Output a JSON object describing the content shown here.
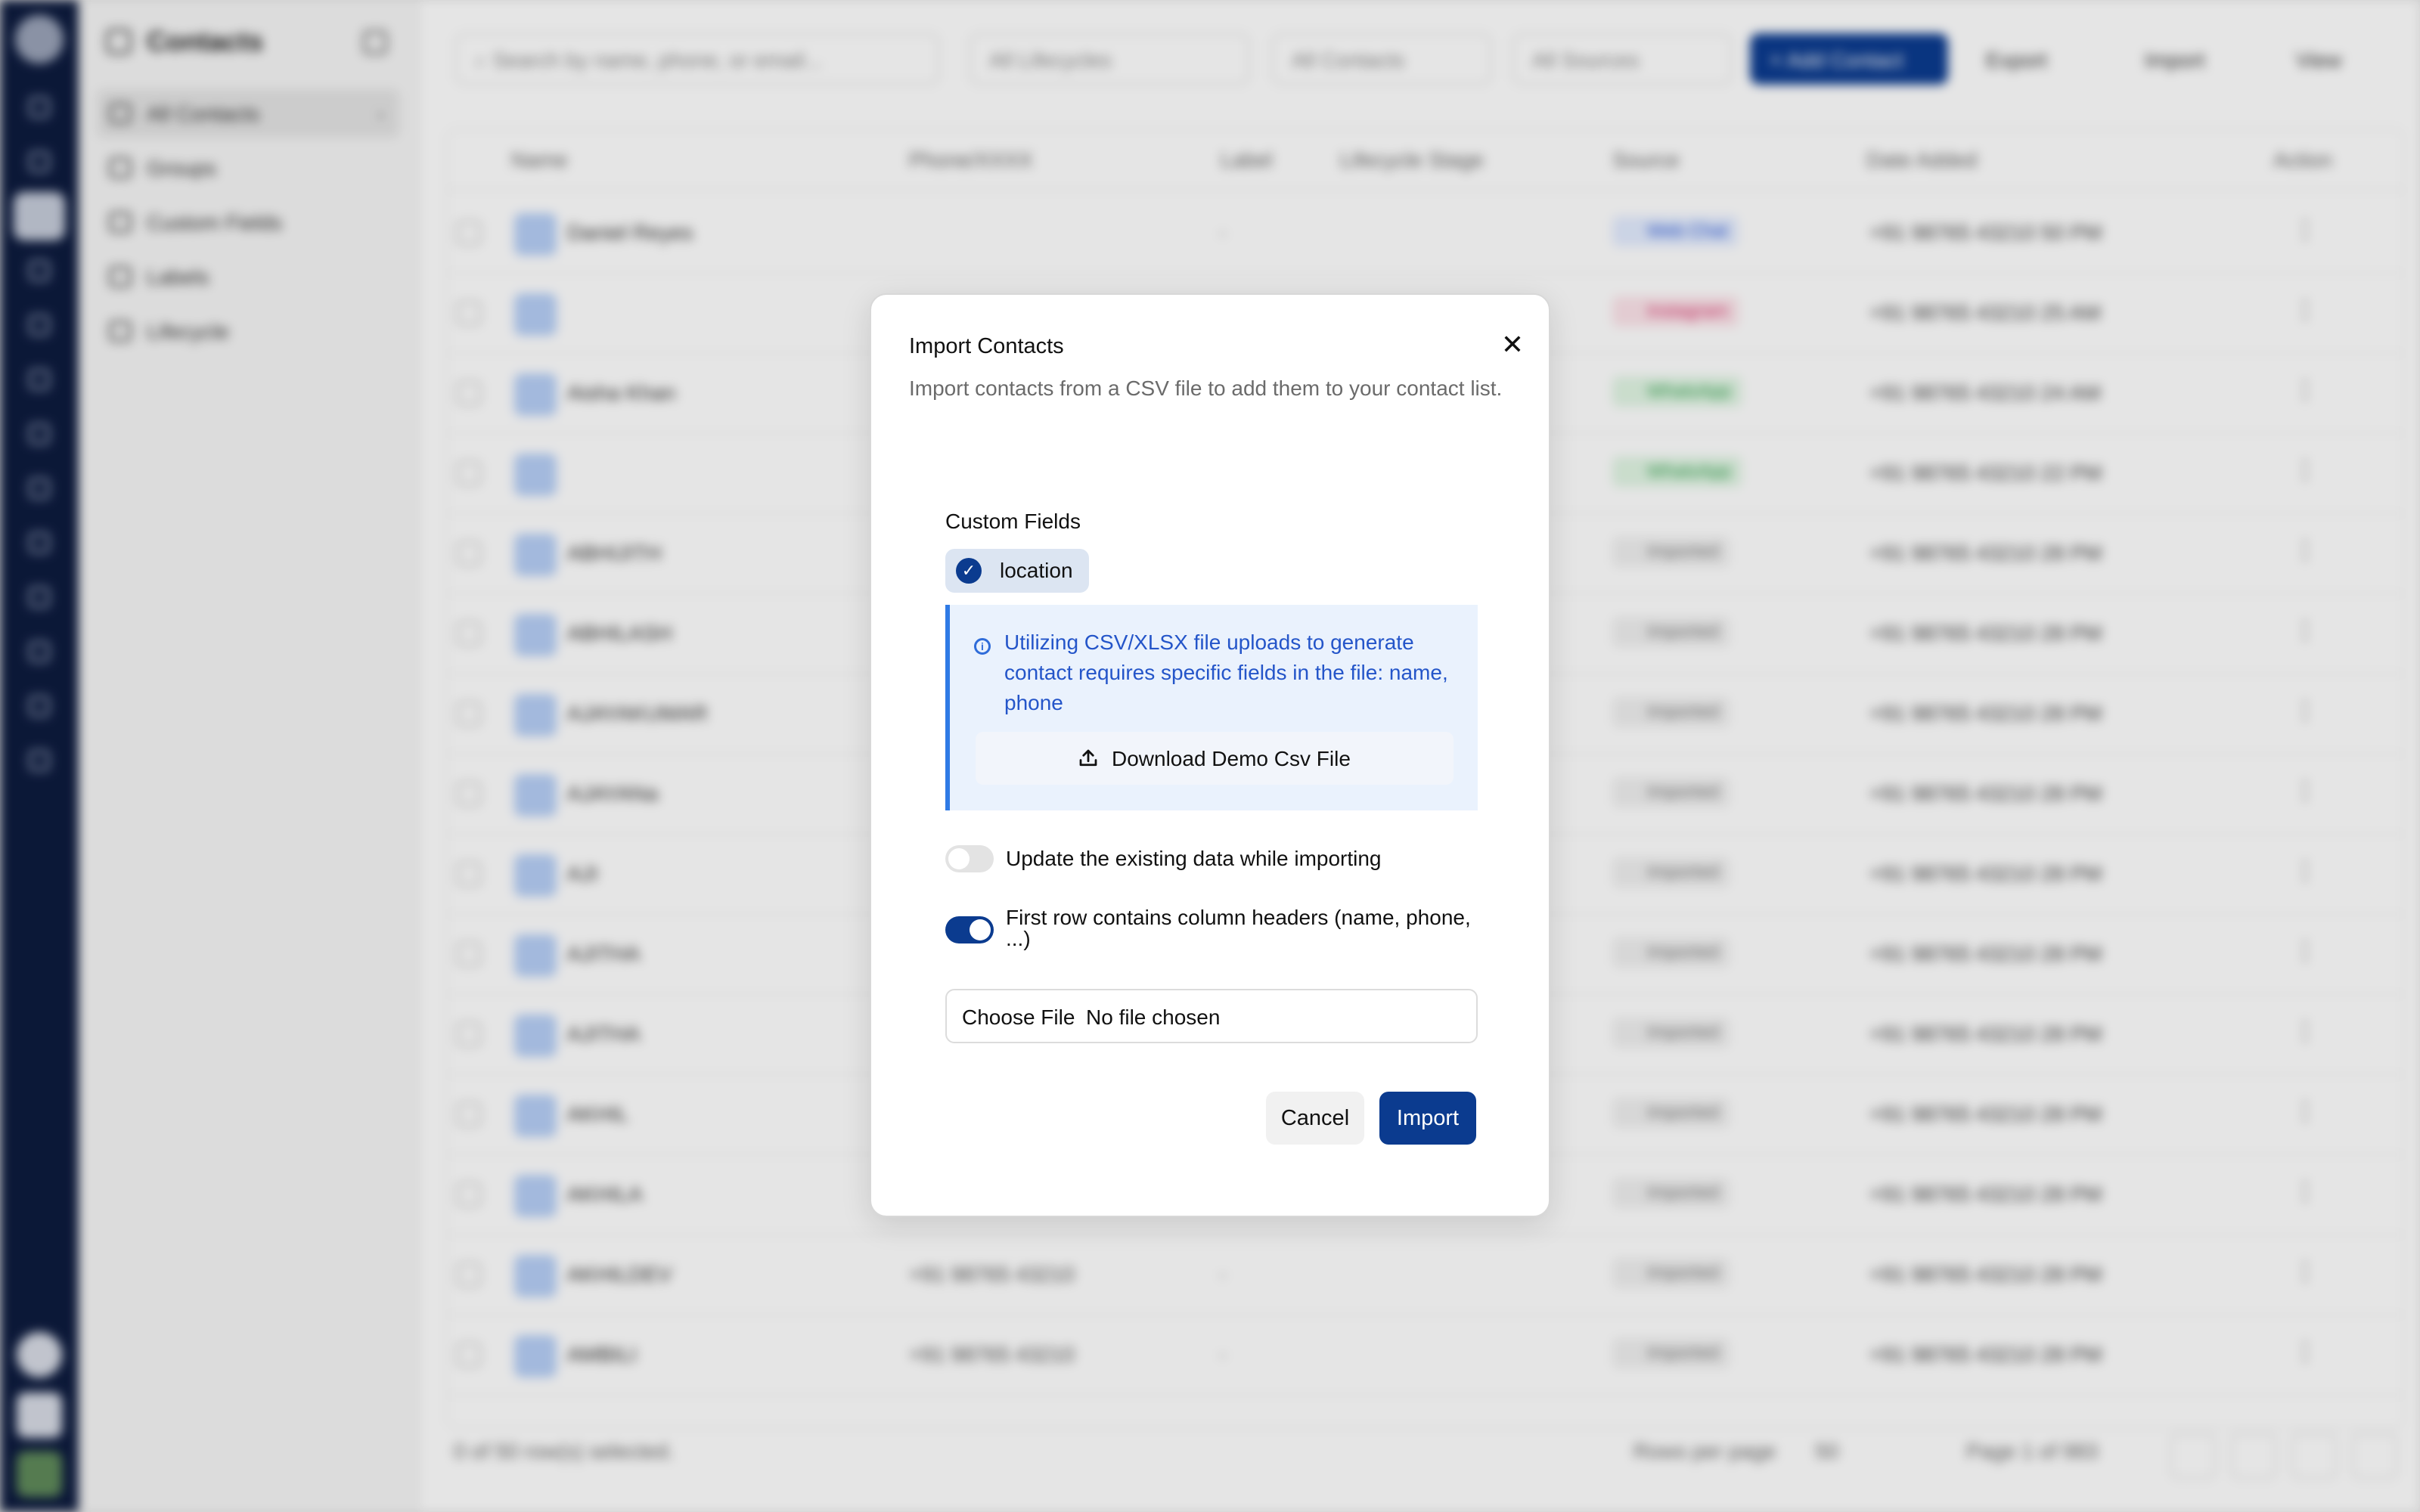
{
  "background": {
    "section_title": "Contacts",
    "subnav": [
      "All Contacts",
      "Groups",
      "Custom Fields",
      "Labels",
      "Lifecycle"
    ],
    "search_placeholder": "Search by name, phone, or email...",
    "filters": [
      "All Lifecycles",
      "All Contacts",
      "All Sources"
    ],
    "actions": [
      "Add Contact",
      "Export",
      "Import",
      "View"
    ],
    "columns": [
      "Name",
      "Phone/XXXX",
      "Label",
      "Lifecycle Stage",
      "Source",
      "Date Added",
      "Action"
    ],
    "rows": [
      {
        "name": "Daniel Reyes",
        "phone": "",
        "label": "-",
        "source": "Web Chat",
        "date": "+91 98765 43210 50 PM"
      },
      {
        "name": "",
        "phone": "",
        "label": "",
        "source": "Instagram",
        "date": "+91 98765 43210 25 AM"
      },
      {
        "name": "Aisha Khan",
        "phone": "",
        "label": "",
        "source": "WhatsApp",
        "date": "+91 98765 43210 24 AM"
      },
      {
        "name": "",
        "phone": "",
        "label": "",
        "source": "WhatsApp",
        "date": "+91 98765 43210 22 PM"
      },
      {
        "name": "ABHIJITH",
        "phone": "",
        "label": "",
        "source": "Imported",
        "date": "+91 98765 43210 28 PM"
      },
      {
        "name": "ABHILASH",
        "phone": "",
        "label": "",
        "source": "Imported",
        "date": "+91 98765 43210 28 PM"
      },
      {
        "name": "AJAYAKUMAR",
        "phone": "",
        "label": "",
        "source": "Imported",
        "date": "+91 98765 43210 28 PM"
      },
      {
        "name": "AJAYANa",
        "phone": "",
        "label": "",
        "source": "Imported",
        "date": "+91 98765 43210 28 PM"
      },
      {
        "name": "AJI",
        "phone": "",
        "label": "",
        "source": "Imported",
        "date": "+91 98765 43210 28 PM"
      },
      {
        "name": "AJITHA",
        "phone": "",
        "label": "",
        "source": "Imported",
        "date": "+91 98765 43210 28 PM"
      },
      {
        "name": "AJITHA",
        "phone": "",
        "label": "",
        "source": "Imported",
        "date": "+91 98765 43210 28 PM"
      },
      {
        "name": "AKHIL",
        "phone": "",
        "label": "",
        "source": "Imported",
        "date": "+91 98765 43210 28 PM"
      },
      {
        "name": "AKHILA",
        "phone": "",
        "label": "",
        "source": "Imported",
        "date": "+91 98765 43210 28 PM"
      },
      {
        "name": "AKHILDEV",
        "phone": "+91 98765 43210",
        "label": "-",
        "source": "Imported",
        "date": "+91 98765 43210 28 PM"
      },
      {
        "name": "AMBILI",
        "phone": "+91 98765 43210",
        "label": "-",
        "source": "Imported",
        "date": "+91 98765 43210 28 PM"
      }
    ],
    "footer": {
      "selected": "0 of 50 row(s) selected.",
      "rows_per_page_label": "Rows per page",
      "rows_per_page_value": "50",
      "page_info": "Page 1 of 983"
    }
  },
  "modal": {
    "title": "Import Contacts",
    "close_glyph": "✕",
    "description": "Import contacts from a CSV file to add them to your contact list.",
    "custom_fields_label": "Custom Fields",
    "custom_field_chip": "location",
    "check_glyph": "✓",
    "info_glyph": "i",
    "info_text": "Utilizing CSV/XLSX file uploads to generate contact requires specific fields in the file: name, phone",
    "download_button": "Download Demo Csv File",
    "toggle_update_label": "Update the existing data while importing",
    "toggle_update_on": false,
    "toggle_headers_label": "First row contains column headers (name, phone, ...)",
    "toggle_headers_on": true,
    "file_button": "Choose File",
    "file_status": "No file chosen",
    "cancel_button": "Cancel",
    "import_button": "Import"
  },
  "colors": {
    "primary": "#0b3b8f",
    "info_bg": "#eaf2fd",
    "info_accent": "#2f7ae5",
    "info_text": "#2455c9"
  }
}
